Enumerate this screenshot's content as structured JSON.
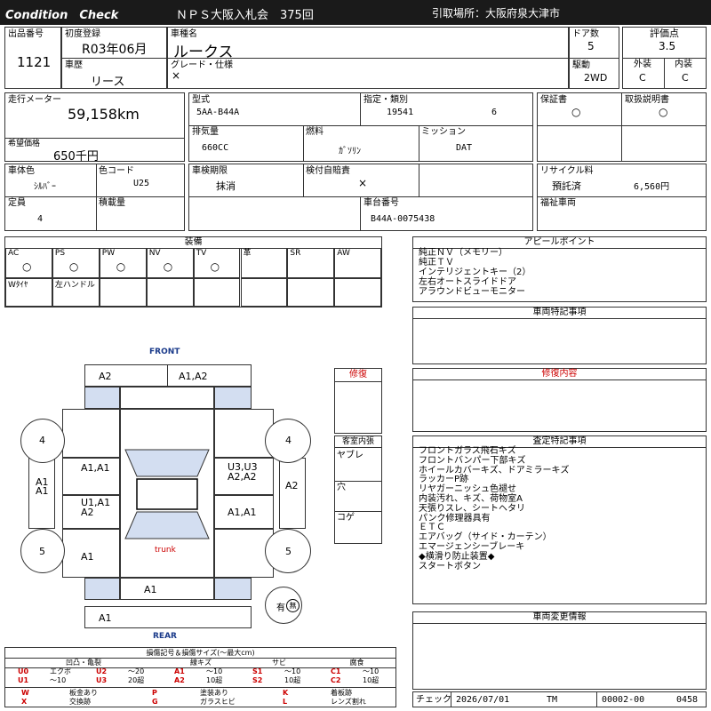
{
  "header": {
    "left_title": "Condition　Check",
    "center_title": "ＮＰＳ大阪入札会　375回",
    "pickup": "引取場所：大阪府泉大津市"
  },
  "row1": {
    "lot_label": "出品番号",
    "lot": "1121",
    "first_reg_label": "初度登録",
    "first_reg": "R03年06月",
    "history_label": "車歴",
    "history": "リース",
    "car_name_label": "車種名",
    "car_name": "ルークス",
    "grade_label": "グレード・仕様",
    "grade": "×",
    "doors_label": "ドア数",
    "doors": "5",
    "drive_label": "駆動",
    "drive": "2WD",
    "score_label": "評価点",
    "score": "3.5",
    "ext_label": "外装",
    "ext": "C",
    "int_label": "内装",
    "int": "C"
  },
  "row2": {
    "mileage_label": "走行メーター",
    "mileage": "59,158km",
    "price_label": "希望価格",
    "price": "650千円",
    "model_label": "型式",
    "model": "5AA-B44A",
    "designation_label": "指定・類別",
    "designation": "19541",
    "category": "6",
    "displacement_label": "排気量",
    "displacement": "660CC",
    "fuel_label": "燃料",
    "fuel": "ｶﾞｿﾘﾝ",
    "mission_label": "ミッション",
    "mission": "DAT",
    "warranty_label": "保証書",
    "warranty": "○",
    "manual_label": "取扱説明書",
    "manual": "○"
  },
  "row3": {
    "color_label": "車体色",
    "color": "ｼﾙﾊﾞｰ",
    "color_code_label": "色コード",
    "color_code": "U25",
    "inspection_label": "車検期限",
    "inspection": "抹消",
    "insurance_label": "検付自賠責",
    "insurance": "×",
    "recycle_label": "リサイクル料",
    "recycle_status": "預託済",
    "recycle_fee": "6,560円",
    "capacity_label": "定員",
    "capacity": "4",
    "load_label": "積載量",
    "load": "",
    "chassis_label": "車台番号",
    "chassis": "B44A-0075438",
    "welfare_label": "福祉車両",
    "welfare": ""
  },
  "equipment": {
    "title": "装備",
    "row1": [
      {
        "label": "AC",
        "mark": "○"
      },
      {
        "label": "PS",
        "mark": "○"
      },
      {
        "label": "PW",
        "mark": "○"
      },
      {
        "label": "NV",
        "mark": "○"
      },
      {
        "label": "TV",
        "mark": "○"
      },
      {
        "label": "革",
        "mark": ""
      },
      {
        "label": "SR",
        "mark": ""
      },
      {
        "label": "AW",
        "mark": ""
      }
    ],
    "row2": [
      "Wﾀｲﾔ",
      "左ハンドル",
      "",
      "",
      "",
      "",
      "",
      ""
    ]
  },
  "appeal": {
    "title": "アピールポイント",
    "lines": [
      "純正ＮＶ（メモリー）",
      "純正ＴＶ",
      "インテリジェントキー（2）",
      "左右オートスライドドア",
      "アラウンドビューモニター"
    ]
  },
  "special": {
    "title": "車両特記事項"
  },
  "repair_content": {
    "title": "修復内容"
  },
  "inspection_notes": {
    "title": "査定特記事項",
    "lines": [
      "フロントガラス飛石キズ",
      "フロントバンパー下部キズ",
      "ホイールカバーキズ、ドアミラーキズ",
      "ラッカーP跡",
      "リヤガーニッシュ色褪せ",
      "内装汚れ、キズ、荷物室A",
      "天張りスレ、シートヘタリ",
      "パンク修理器具有",
      "ＥＴＣ",
      "エアバッグ（サイド・カーテン）",
      "エマージェンシーブレーキ",
      "◆横滑り防止装置◆",
      "スタートボタン"
    ]
  },
  "changes": {
    "title": "車両変更情報"
  },
  "diagram": {
    "front": "FRONT",
    "rear": "REAR",
    "trunk": "trunk",
    "marks": {
      "hood_left": "A2",
      "hood_right": "A1,A2",
      "tire_fl": "4",
      "tire_fr": "4",
      "tire_rl": "5",
      "tire_rr": "5",
      "front_door_l": "A1,A1",
      "front_door_r": "U3,U3\nA2,A2",
      "sill_l": "A1\nA1",
      "sill_r": "A2",
      "rear_door_l": "U1,A1\nA2",
      "rear_door_r": "A1,A1",
      "quarter_l": "A1",
      "rear_bumper": "A1",
      "rear_lower": "A1",
      "spare": "有",
      "spare_icon": "無"
    },
    "repair_label": "修復",
    "interior_label": "客室内張",
    "interior_rows": [
      "ヤブレ",
      "穴",
      "コゲ"
    ]
  },
  "legend": {
    "title": "損傷記号＆損傷サイズ(〜最大cm)",
    "headers": [
      "凹凸・亀裂",
      "線キズ",
      "サビ",
      "腐食"
    ],
    "rows": [
      [
        [
          "U0",
          "エクボ"
        ],
        [
          "U2",
          "〜20"
        ],
        [
          "A1",
          "〜10"
        ],
        [
          "S1",
          "〜10"
        ],
        [
          "C1",
          "〜10"
        ]
      ],
      [
        [
          "U1",
          "〜10"
        ],
        [
          "U3",
          "20超"
        ],
        [
          "A2",
          "10超"
        ],
        [
          "S2",
          "10超"
        ],
        [
          "C2",
          "10超"
        ]
      ]
    ],
    "marks": [
      [
        [
          "W",
          "板金あり"
        ],
        [
          "P",
          "塗装あり"
        ],
        [
          "K",
          "着板跡"
        ]
      ],
      [
        [
          "X",
          "交換跡"
        ],
        [
          "G",
          "ガラスヒビ"
        ],
        [
          "L",
          "レンズ割れ"
        ]
      ]
    ]
  },
  "footer": {
    "check_label": "チェック",
    "date": "2026/07/01",
    "tm": "TM",
    "code": "00002-00",
    "num": "0458"
  },
  "colors": {
    "header_bg": "#1a1a1a",
    "panel_blue": "#d3def1",
    "red": "#cc0000",
    "navy": "#1a3a8a"
  }
}
